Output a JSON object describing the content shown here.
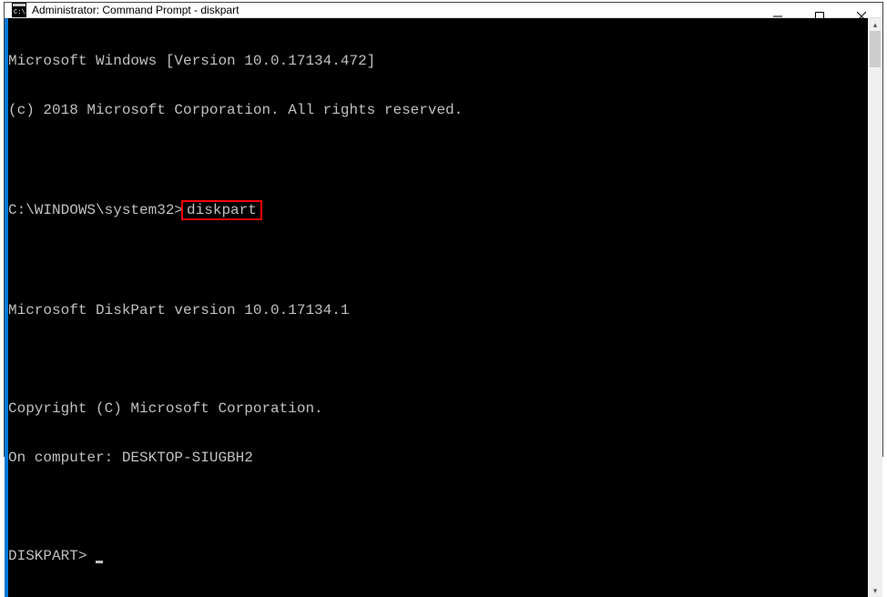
{
  "titlebar": {
    "title": "Administrator: Command Prompt - diskpart"
  },
  "terminal": {
    "line1": "Microsoft Windows [Version 10.0.17134.472]",
    "line2": "(c) 2018 Microsoft Corporation. All rights reserved.",
    "prompt_path": "C:\\WINDOWS\\system32>",
    "command": "diskpart",
    "line4": "Microsoft DiskPart version 10.0.17134.1",
    "line5": "Copyright (C) Microsoft Corporation.",
    "line6": "On computer: DESKTOP-SIUGBH2",
    "prompt2": "DISKPART> "
  }
}
